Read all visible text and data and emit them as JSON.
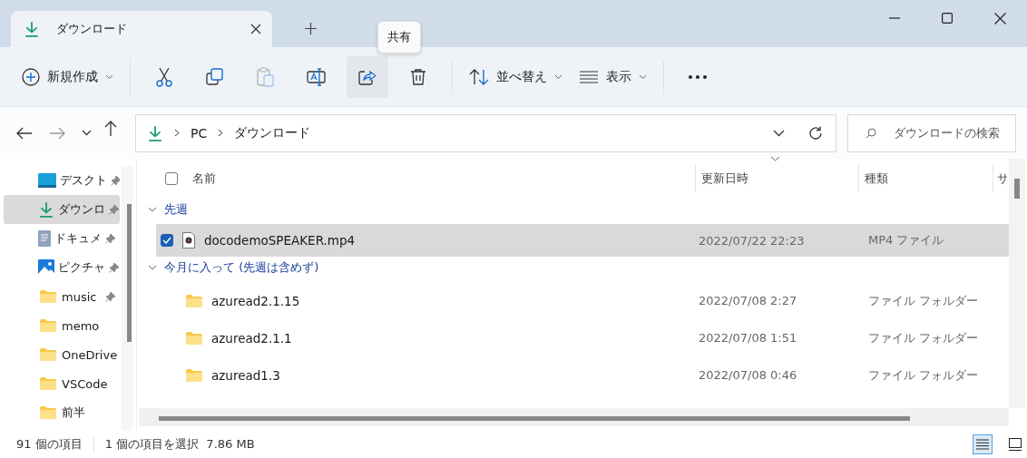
{
  "tabs": [
    {
      "label": "ダウンロード",
      "selected": true
    }
  ],
  "tooltip": "共有",
  "toolbar": [
    {
      "kind": "new",
      "label": "新規作成",
      "disabled": false,
      "hovered": false
    },
    {
      "kind": "cut",
      "disabled": false,
      "hovered": false
    },
    {
      "kind": "copy",
      "disabled": false,
      "hovered": false
    },
    {
      "kind": "paste",
      "disabled": true,
      "hovered": false
    },
    {
      "kind": "rename",
      "disabled": false,
      "hovered": false
    },
    {
      "kind": "share",
      "disabled": false,
      "hovered": true
    },
    {
      "kind": "delete",
      "disabled": false,
      "hovered": false
    },
    {
      "kind": "sort",
      "label": "並べ替え",
      "disabled": false,
      "hovered": false
    },
    {
      "kind": "view",
      "label": "表示",
      "disabled": false,
      "hovered": false
    },
    {
      "kind": "more",
      "disabled": false,
      "hovered": false
    }
  ],
  "address": {
    "crumbs": [
      "PC",
      "ダウンロード"
    ],
    "search_placeholder": "ダウンロードの検索"
  },
  "sidebar": {
    "items": [
      {
        "kind": "desktop",
        "label": "デスクト",
        "pinned": true,
        "selected": false
      },
      {
        "kind": "download",
        "label": "ダウンロ",
        "pinned": true,
        "selected": true
      },
      {
        "kind": "document",
        "label": "ドキュメ",
        "pinned": true,
        "selected": false
      },
      {
        "kind": "pictures",
        "label": "ピクチャ",
        "pinned": true,
        "selected": false
      },
      {
        "kind": "folder",
        "label": "music",
        "pinned": true,
        "selected": false
      },
      {
        "kind": "folder",
        "label": "memo",
        "pinned": false,
        "selected": false
      },
      {
        "kind": "folder",
        "label": "OneDrive",
        "pinned": false,
        "selected": false
      },
      {
        "kind": "folder",
        "label": "VSCode",
        "pinned": false,
        "selected": false
      },
      {
        "kind": "folder",
        "label": "前半",
        "pinned": false,
        "selected": false
      }
    ]
  },
  "table": {
    "select_all_checked": false,
    "columns": [
      "名前",
      "更新日時",
      "種類",
      "サ"
    ],
    "groups": [
      {
        "label": "先週",
        "expanded": true,
        "rows": [
          {
            "kind": "video",
            "name": "docodemoSPEAKER.mp4",
            "modified": "2022/07/22 22:23",
            "type": "MP4 ファイル",
            "selected": true,
            "checked": true
          }
        ]
      },
      {
        "label": "今月に入って (先週は含めず)",
        "expanded": true,
        "rows": [
          {
            "kind": "folder",
            "name": "azuread2.1.15",
            "modified": "2022/07/08 2:27",
            "type": "ファイル フォルダー",
            "selected": false,
            "checked": false
          },
          {
            "kind": "folder",
            "name": "azuread2.1.1",
            "modified": "2022/07/08 1:51",
            "type": "ファイル フォルダー",
            "selected": false,
            "checked": false
          },
          {
            "kind": "folder",
            "name": "azuread1.3",
            "modified": "2022/07/08 0:46",
            "type": "ファイル フォルダー",
            "selected": false,
            "checked": false
          }
        ]
      }
    ]
  },
  "status_bar": {
    "count": "91 個の項目",
    "selection": "1 個の項目を選択  7.86 MB",
    "views": [
      {
        "kind": "details",
        "selected": true
      },
      {
        "kind": "preview",
        "selected": false
      }
    ]
  }
}
